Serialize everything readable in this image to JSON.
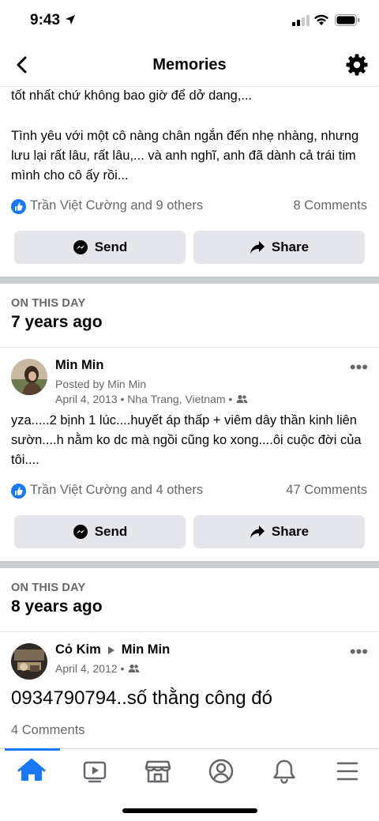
{
  "status": {
    "time": "9:43"
  },
  "header": {
    "title": "Memories"
  },
  "post1": {
    "text_top": "tốt nhất chứ không bao giờ để dở dang,...",
    "text_body": "Tình yêu với một cô nàng chân ngắn đến nhẹ nhàng, nhưng lưu lại rất lâu, rất lâu,... và anh nghĩ, anh đã dành cả trái tim mình cho cô ấy rồi...",
    "reactions": "Trần Việt Cường and 9 others",
    "comments": "8 Comments"
  },
  "actions": {
    "send_label": "Send",
    "share_label": "Share"
  },
  "section2": {
    "label": "ON THIS DAY",
    "years": "7 years ago"
  },
  "post2": {
    "author": "Min Min",
    "posted_by": "Posted by Min Min",
    "date_location": "April 4, 2013 • Nha Trang, Vietnam •",
    "text": "yza.....2 bịnh 1 lúc....huyết áp thấp + viêm dây thần kinh liên sườn....h nằm ko dc mà ngồi cũng ko xong....ôi cuộc đời của tôi....",
    "reactions": "Trần Việt Cường and 4 others",
    "comments": "47 Comments"
  },
  "section3": {
    "label": "ON THIS DAY",
    "years": "8 years ago"
  },
  "post3": {
    "author_from": "Cỏ Kim",
    "author_to": "Min Min",
    "date": "April 4, 2012 •",
    "text": "0934790794..số thằng công đó",
    "comments": "4 Comments"
  },
  "colors": {
    "accent": "#1877f2",
    "secondary_text": "#65676b",
    "button_bg": "#e4e6eb"
  },
  "tabs": [
    "home-icon",
    "watch-icon",
    "marketplace-icon",
    "profile-icon",
    "notifications-icon",
    "menu-icon"
  ]
}
